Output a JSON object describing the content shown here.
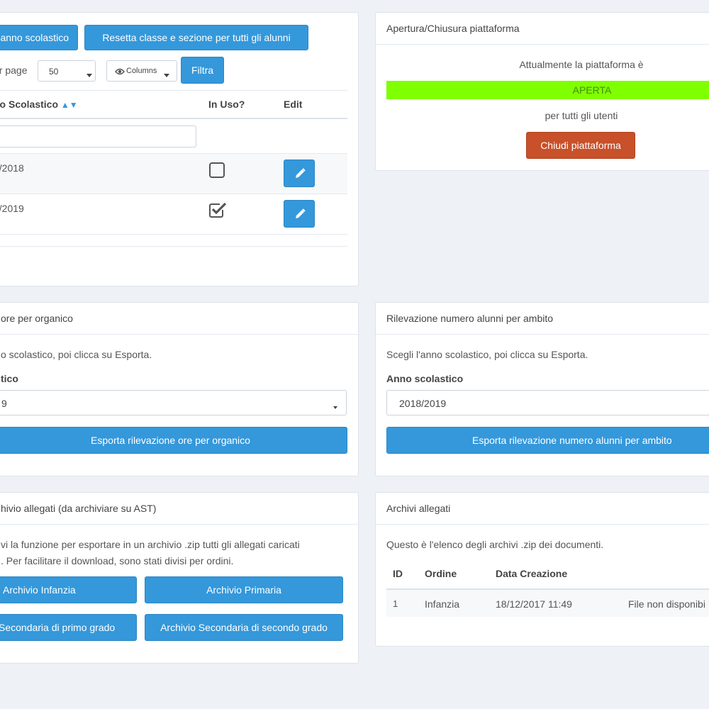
{
  "top_left": {
    "btn_anno": "anno scolastico",
    "btn_resetta": "Resetta classe e sezione per tutti gli alunni",
    "per_page_label": "er page",
    "per_page_value": "50",
    "columns_label": "Columns",
    "filtra_label": "Filtra",
    "table": {
      "col_anno": "no Scolastico",
      "col_inuso": "In Uso?",
      "col_edit": "Edit",
      "rows": [
        {
          "anno": "7/2018",
          "in_uso": false
        },
        {
          "anno": "8/2019",
          "in_uso": true
        }
      ]
    }
  },
  "piattaforma": {
    "title": "Apertura/Chiusura piattaforma",
    "line1": "Attualmente la piattaforma è",
    "status": "APERTA",
    "status_color": "#7fff00",
    "line2": "per tutti gli utenti",
    "btn_chiudi": "Chiudi piattaforma",
    "btn_color": "#c8502a"
  },
  "ore_organico": {
    "title": "ore per organico",
    "desc": "o scolastico, poi clicca su Esporta.",
    "label": "tico",
    "select_value": "9",
    "btn_export": "Esporta rilevazione ore per organico"
  },
  "alunni_ambito": {
    "title": "Rilevazione numero alunni per ambito",
    "desc": "Scegli l'anno scolastico, poi clicca su Esporta.",
    "label": "Anno scolastico",
    "select_value": "2018/2019",
    "btn_export": "Esporta rilevazione numero alunni per ambito"
  },
  "archivio_allegati": {
    "title": "hivio allegati (da archiviare su AST)",
    "desc1": "vi la funzione per esportare in un archivio .zip tutti gli allegati caricati",
    "desc2": ". Per facilitare il download, sono stati divisi per ordini.",
    "btn_infanzia": "Archivio Infanzia",
    "btn_primaria": "Archivio Primaria",
    "btn_sec1": "Secondaria di primo grado",
    "btn_sec2": "Archivio Secondaria di secondo grado"
  },
  "archivi": {
    "title": "Archivi allegati",
    "desc": "Questo è l'elenco degli archivi .zip dei documenti.",
    "col_id": "ID",
    "col_ordine": "Ordine",
    "col_data": "Data Creazione",
    "rows": [
      {
        "id": "1",
        "ordine": "Infanzia",
        "data": "18/12/2017 11:49",
        "file": "File non disponibi"
      }
    ]
  },
  "colors": {
    "primary": "#3498db",
    "background": "#eef1f5"
  }
}
